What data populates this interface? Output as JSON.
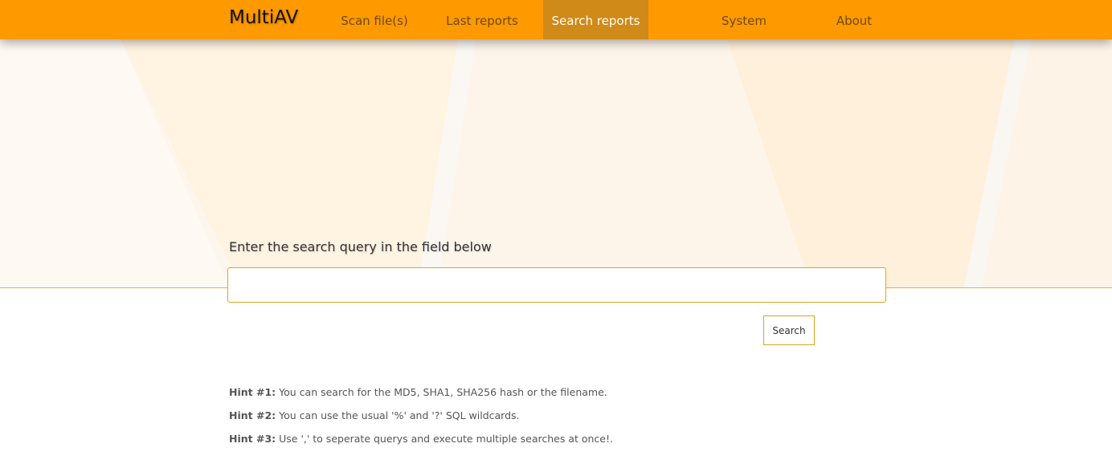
{
  "nav": {
    "brand": "MultiAV",
    "items": [
      {
        "label": "Scan file(s)"
      },
      {
        "label": "Last reports"
      },
      {
        "label": "Search reports"
      },
      {
        "label": "System"
      },
      {
        "label": "About"
      }
    ],
    "active": "Search reports"
  },
  "search": {
    "prompt": "Enter the search query in the field below",
    "value": "",
    "button_label": "Search"
  },
  "hints": [
    {
      "label": "Hint #1:",
      "text": "You can search for the MD5, SHA1, SHA256 hash or the filename."
    },
    {
      "label": "Hint #2:",
      "text": "You can use the usual '%' and '?' SQL wildcards."
    },
    {
      "label": "Hint #3:",
      "text": "Use ',' to seperate querys and execute multiple searches at once!."
    }
  ],
  "colors": {
    "navbar": "#ff9900",
    "nav_active": "#d08a17",
    "accent_border": "#d9a520"
  }
}
